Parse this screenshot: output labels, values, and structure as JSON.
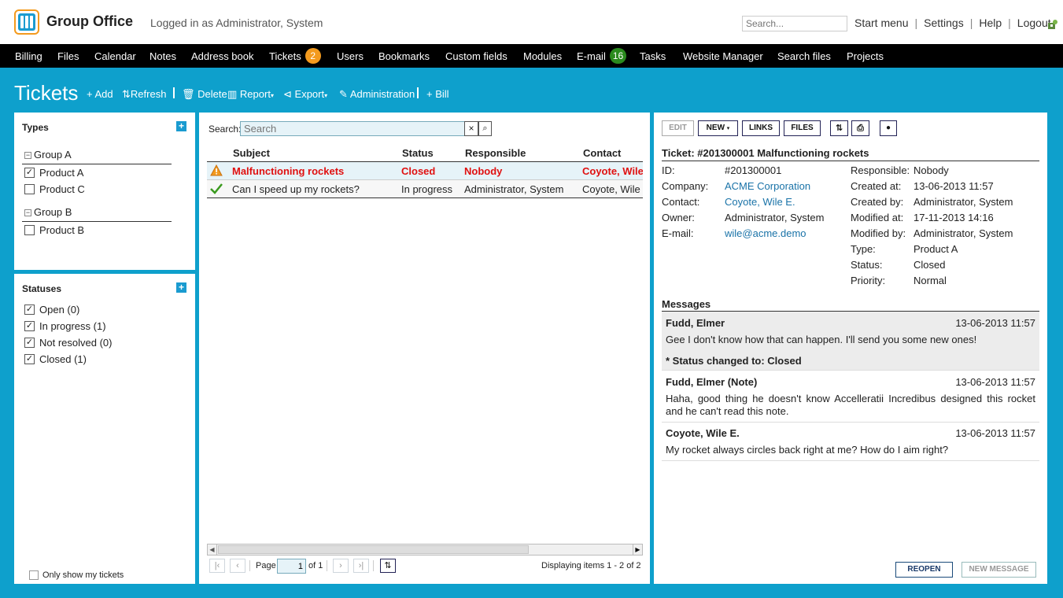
{
  "app": {
    "name": "Group Office",
    "logged_in": "Logged in as Administrator, System"
  },
  "top": {
    "search_placeholder": "Search...",
    "links": [
      "Start menu",
      "Settings",
      "Help",
      "Logout"
    ]
  },
  "nav": [
    {
      "label": "Billing"
    },
    {
      "label": "Files"
    },
    {
      "label": "Calendar"
    },
    {
      "label": "Notes"
    },
    {
      "label": "Address book"
    },
    {
      "label": "Tickets",
      "badge": "2",
      "badge_color": "#f39a1e",
      "active": true
    },
    {
      "label": "Users"
    },
    {
      "label": "Bookmarks"
    },
    {
      "label": "Custom fields"
    },
    {
      "label": "Modules"
    },
    {
      "label": "E-mail",
      "badge": "16",
      "badge_color": "#2a8a1e"
    },
    {
      "label": "Tasks"
    },
    {
      "label": "Website Manager"
    },
    {
      "label": "Search files"
    },
    {
      "label": "Projects"
    }
  ],
  "page": {
    "title": "Tickets"
  },
  "toolbar": {
    "add": "Add",
    "refresh": "Refresh",
    "delete": "Delete",
    "report": "Report",
    "export": "Export",
    "administration": "Administration",
    "bill": "Bill"
  },
  "types": {
    "title": "Types",
    "groups": [
      {
        "name": "Group A",
        "items": [
          {
            "label": "Product A",
            "checked": true
          },
          {
            "label": "Product C",
            "checked": false
          }
        ]
      },
      {
        "name": "Group B",
        "items": [
          {
            "label": "Product B",
            "checked": false
          }
        ]
      }
    ]
  },
  "statuses": {
    "title": "Statuses",
    "items": [
      {
        "label": "Open (0)",
        "checked": true
      },
      {
        "label": "In progress (1)",
        "checked": true
      },
      {
        "label": "Not resolved (0)",
        "checked": true
      },
      {
        "label": "Closed (1)",
        "checked": true
      }
    ],
    "only_mine": "Only show my tickets"
  },
  "grid": {
    "search_label": "Search:",
    "search_placeholder": "Search",
    "columns": [
      "Subject",
      "Status",
      "Responsible",
      "Contact"
    ],
    "rows": [
      {
        "icon": "warning-icon",
        "subject": "Malfunctioning rockets",
        "status": "Closed",
        "responsible": "Nobody",
        "contact": "Coyote, Wile E.",
        "selected": true,
        "highlight": true
      },
      {
        "icon": "check-icon",
        "subject": "Can I speed up my rockets?",
        "status": "In progress",
        "responsible": "Administrator, System",
        "contact": "Coyote, Wile E.",
        "selected": false,
        "highlight": false
      }
    ],
    "paging": {
      "page_label": "Page",
      "page_value": "1",
      "of_label": "of 1",
      "displaying": "Displaying items 1 - 2 of 2"
    }
  },
  "detail": {
    "buttons": {
      "edit": "EDIT",
      "new": "NEW",
      "links": "LINKS",
      "files": "FILES"
    },
    "heading": "Ticket: #201300001 Malfunctioning rockets",
    "left_fields": [
      {
        "label": "ID:",
        "value": "#201300001",
        "link": false
      },
      {
        "label": "Company:",
        "value": "ACME Corporation",
        "link": true
      },
      {
        "label": "Contact:",
        "value": "Coyote, Wile E.",
        "link": true
      },
      {
        "label": "Owner:",
        "value": "Administrator, System",
        "link": false
      },
      {
        "label": "E-mail:",
        "value": "wile@acme.demo",
        "link": true
      }
    ],
    "right_fields": [
      {
        "label": "Responsible:",
        "value": "Nobody"
      },
      {
        "label": "Created at:",
        "value": "13-06-2013 11:57"
      },
      {
        "label": "Created by:",
        "value": "Administrator, System"
      },
      {
        "label": "Modified at:",
        "value": "17-11-2013 14:16"
      },
      {
        "label": "Modified by:",
        "value": "Administrator, System"
      },
      {
        "label": "Type:",
        "value": "Product A"
      },
      {
        "label": "Status:",
        "value": "Closed"
      },
      {
        "label": "Priority:",
        "value": "Normal"
      }
    ],
    "messages_title": "Messages",
    "messages": [
      {
        "author": "Fudd, Elmer",
        "time": "13-06-2013 11:57",
        "text": "Gee I don't know how that can happen. I'll send you some new ones!",
        "status_change": "* Status changed to: Closed",
        "shaded": true
      },
      {
        "author": "Fudd, Elmer (Note)",
        "time": "13-06-2013 11:57",
        "text": "Haha, good thing he doesn't know Accelleratii Incredibus designed this rocket and he can't read this note.",
        "status_change": "",
        "shaded": false
      },
      {
        "author": "Coyote, Wile E.",
        "time": "13-06-2013 11:57",
        "text": "My rocket always circles back right at me? How do I aim right?",
        "status_change": "",
        "shaded": false
      }
    ],
    "reopen": "REOPEN",
    "new_message": "NEW MESSAGE"
  }
}
